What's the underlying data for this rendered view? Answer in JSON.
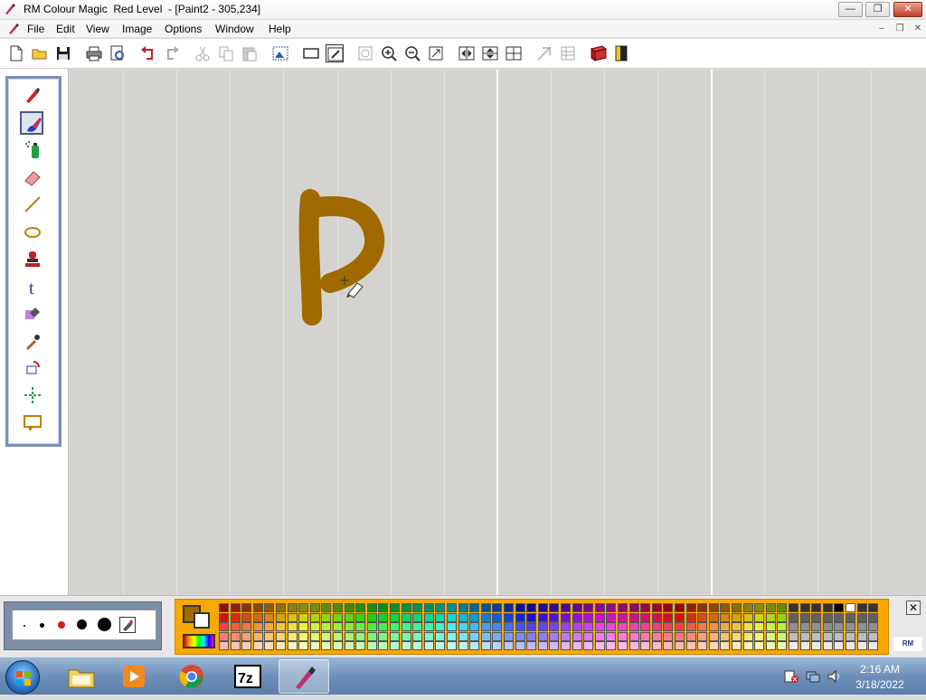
{
  "window": {
    "title": "RM Colour Magic  Red Level  - [Paint2 - 305,234]"
  },
  "menubar": {
    "items": [
      "File",
      "Edit",
      "View",
      "Image",
      "Options",
      "Window",
      "Help"
    ]
  },
  "toolbar": {
    "buttons": [
      "new-icon",
      "open-folder-icon",
      "save-icon",
      "print-icon",
      "print-preview-icon",
      "undo-icon",
      "redo-icon",
      "cut-icon",
      "copy-icon",
      "paste-icon",
      "select-picture-icon",
      "rectangle-frame-icon",
      "magic-frame-icon",
      "zoom-icon",
      "zoom-in-icon",
      "zoom-out-icon",
      "resize-icon",
      "flip-horizontal-icon",
      "flip-vertical-icon",
      "rotate-icon",
      "effects-icon",
      "grid-icon",
      "book-icon",
      "exit-icon"
    ]
  },
  "tools": [
    "pen-icon",
    "paintbrush-icon",
    "spray-can-icon",
    "eraser-icon",
    "line-icon",
    "ellipse-icon",
    "stamp-icon",
    "text-icon",
    "fill-icon",
    "eyedropper-icon",
    "rotate-tool-icon",
    "symmetry-icon",
    "frame-icon"
  ],
  "colors": {
    "current_foreground": "#a06a00",
    "current_background": "#ffffff",
    "canvas_background": "#d5d3cf",
    "stroke_color": "#a06a00"
  },
  "taskbar": {
    "apps": [
      "file-explorer-icon",
      "media-player-icon",
      "chrome-icon",
      "7zip-icon",
      "colour-magic-icon"
    ],
    "active_app": "colour-magic-icon",
    "clock_time": "2:16 AM",
    "clock_date": "3/18/2022"
  },
  "palette": {
    "close_label": "✕",
    "logo_text": "RM"
  }
}
